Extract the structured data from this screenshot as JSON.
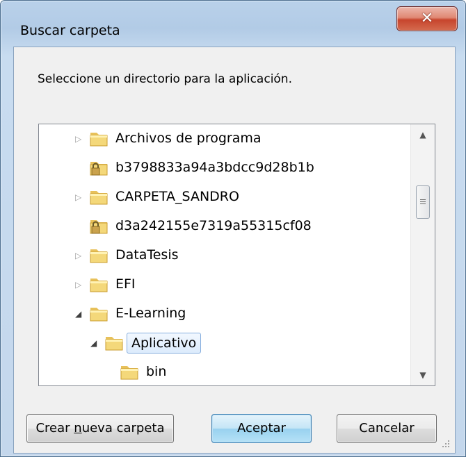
{
  "window": {
    "title": "Buscar carpeta",
    "close_icon": "close-icon"
  },
  "dialog": {
    "prompt": "Seleccione un directorio para la aplicación."
  },
  "tree": {
    "items": [
      {
        "label": "Archivos de programa",
        "expander": "collapsed",
        "icon": "folder-icon"
      },
      {
        "label": "b3798833a94a3bdcc9d28b1b",
        "expander": "none",
        "icon": "locked-folder-icon"
      },
      {
        "label": "CARPETA_SANDRO",
        "expander": "collapsed",
        "icon": "folder-icon"
      },
      {
        "label": "d3a242155e7319a55315cf08",
        "expander": "none",
        "icon": "locked-folder-icon"
      },
      {
        "label": "DataTesis",
        "expander": "collapsed",
        "icon": "folder-icon"
      },
      {
        "label": "EFI",
        "expander": "collapsed",
        "icon": "folder-icon"
      },
      {
        "label": "E-Learning",
        "expander": "expanded",
        "icon": "folder-icon"
      },
      {
        "label": "Aplicativo",
        "expander": "expanded",
        "icon": "folder-icon",
        "selected": true
      },
      {
        "label": "bin",
        "expander": "none",
        "icon": "folder-icon"
      }
    ]
  },
  "buttons": {
    "new_folder": {
      "before": "Crear ",
      "underline": "n",
      "after": "ueva carpeta"
    },
    "accept": "Aceptar",
    "cancel": "Cancelar"
  },
  "colors": {
    "selection_border": "#84acdd",
    "default_button_border": "#3c7fb1",
    "close_button": "#c7452d"
  }
}
